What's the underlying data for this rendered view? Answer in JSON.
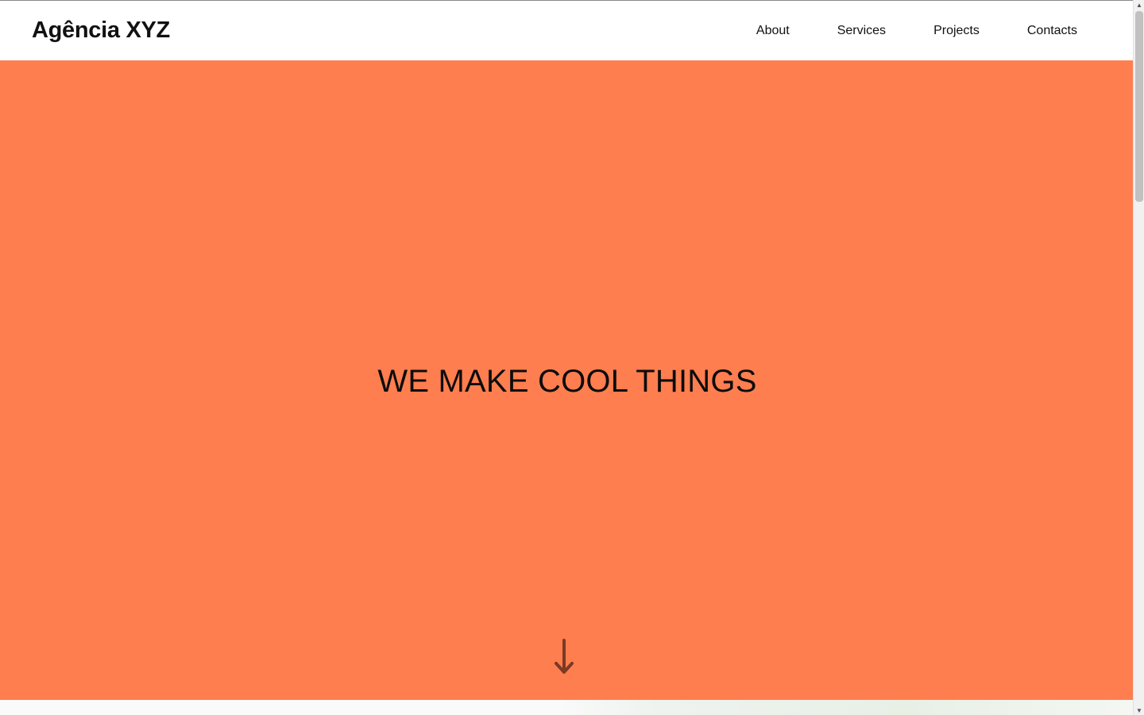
{
  "header": {
    "logo": "Agência XYZ",
    "nav": [
      {
        "label": "About"
      },
      {
        "label": "Services"
      },
      {
        "label": "Projects"
      },
      {
        "label": "Contacts"
      }
    ]
  },
  "hero": {
    "title": "WE MAKE COOL THINGS",
    "background_color": "#ff7e4f",
    "scroll_icon": "arrow-down-icon"
  },
  "colors": {
    "accent": "#ff7e4f",
    "text": "#111111",
    "arrow": "#7a3a24"
  }
}
